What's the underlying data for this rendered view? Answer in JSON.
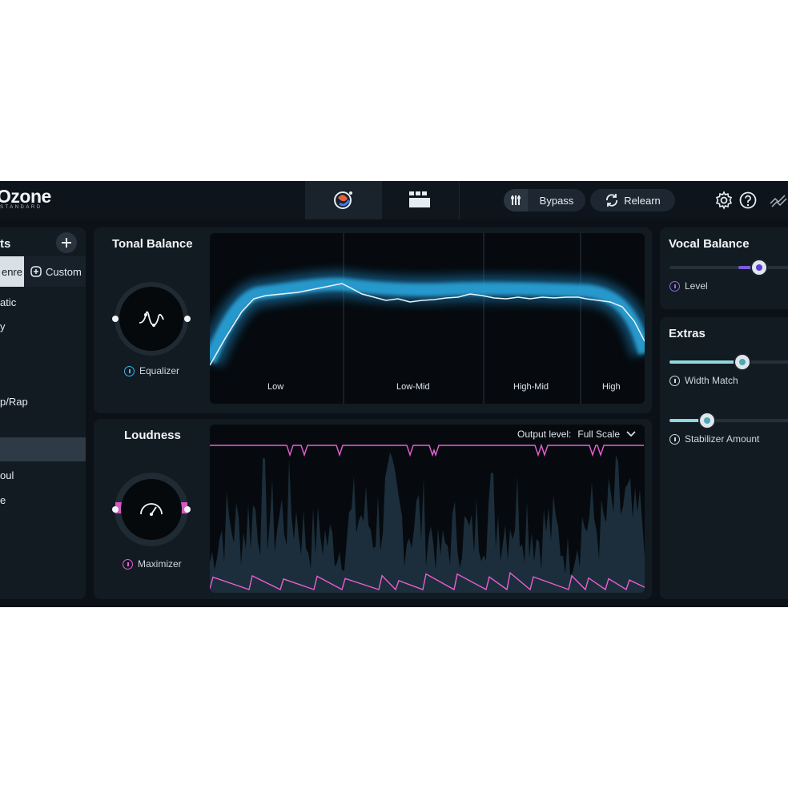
{
  "app": {
    "logo": "Ozone",
    "logo_sub": "STANDARD"
  },
  "toolbar": {
    "bypass_label": "Bypass",
    "relearn_label": "Relearn",
    "icons": [
      "assistant-orb-icon",
      "modules-grid-icon",
      "gear-icon",
      "help-icon",
      "meter-icon"
    ]
  },
  "sidebar": {
    "title": "ts",
    "tabs": {
      "genre_label": "enre",
      "custom_label": "Custom"
    },
    "items": [
      {
        "label": "atic"
      },
      {
        "label": "y"
      },
      {
        "label": "p/Rap"
      },
      {
        "label": ""
      },
      {
        "label": "oul"
      },
      {
        "label": "e"
      }
    ],
    "selected_index": 3
  },
  "tonal_balance": {
    "title": "Tonal Balance",
    "module_label": "Equalizer",
    "bands": [
      "Low",
      "Low-Mid",
      "High-Mid",
      "High"
    ]
  },
  "loudness": {
    "title": "Loudness",
    "module_label": "Maximizer",
    "output_label": "Output level:",
    "output_value": "Full Scale"
  },
  "vocal_balance": {
    "title": "Vocal Balance",
    "level_label": "Level",
    "level_value": 0.7
  },
  "extras": {
    "title": "Extras",
    "width_match_label": "Width Match",
    "width_match_value": 0.6,
    "stabilizer_label": "Stabilizer Amount",
    "stabilizer_value": 0.3
  },
  "colors": {
    "accent_blue": "#3fb6e8",
    "accent_pink": "#e85fd2",
    "accent_purple": "#7a5bdc",
    "teal": "#8fd8e0"
  }
}
